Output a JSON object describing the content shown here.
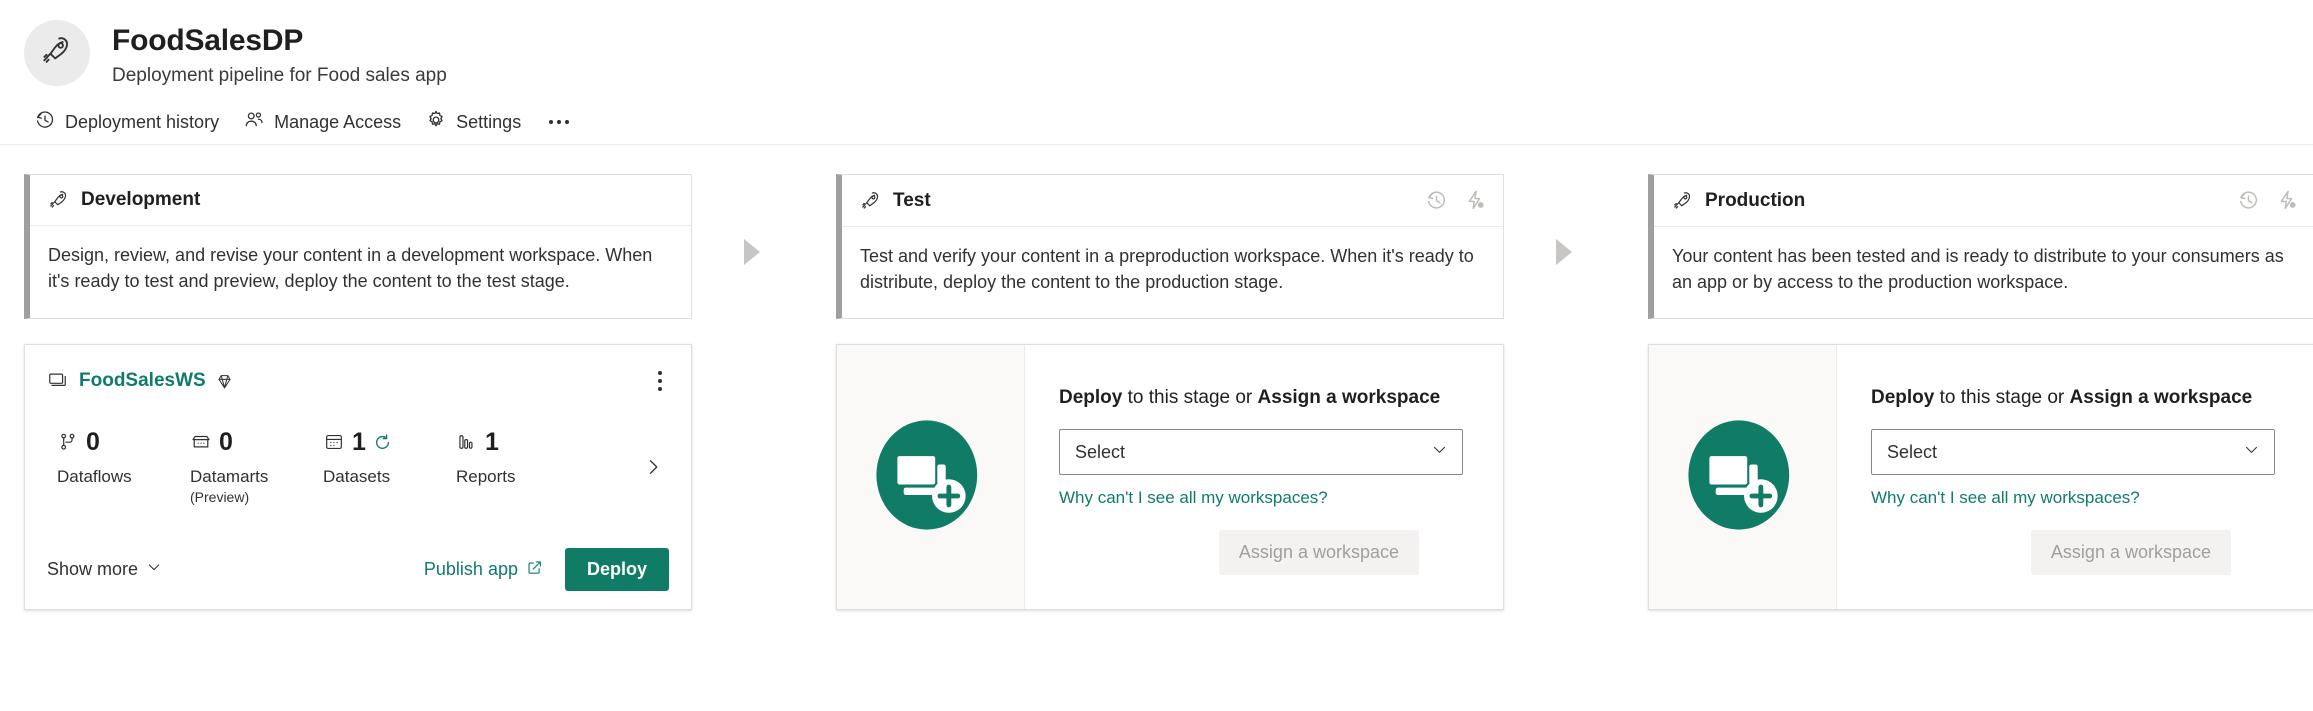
{
  "header": {
    "avatar_icon": "rocket-icon",
    "title": "FoodSalesDP",
    "subtitle": "Deployment pipeline for Food sales app"
  },
  "toolbar": {
    "items": [
      {
        "label": "Deployment history",
        "icon": "history-icon"
      },
      {
        "label": "Manage Access",
        "icon": "people-icon"
      },
      {
        "label": "Settings",
        "icon": "gear-icon"
      }
    ],
    "overflow_label": "More options"
  },
  "colors": {
    "accent_teal": "#107c66",
    "link_teal": "#0f7b6c",
    "stage_accent_bar": "#a19f9d",
    "connector": "#c8c6c4"
  },
  "stages": [
    {
      "name": "Development",
      "icon": "rocket-icon",
      "description": "Design, review, and revise your content in a development workspace. When it's ready to test and preview, deploy the content to the test stage.",
      "head_icons": []
    },
    {
      "name": "Test",
      "icon": "rocket-icon",
      "description": "Test and verify your content in a preproduction workspace. When it's ready to distribute, deploy the content to the production stage.",
      "head_icons": [
        "history-icon",
        "deployment-rules-icon"
      ]
    },
    {
      "name": "Production",
      "icon": "rocket-icon",
      "description": "Your content has been tested and is ready to distribute to your consumers as an app or by access to the production workspace.",
      "head_icons": [
        "history-icon",
        "deployment-rules-icon"
      ]
    }
  ],
  "workspace_card": {
    "name": "FoodSalesWS",
    "workspace_icon": "workspace-icon",
    "premium_icon": "diamond-icon",
    "more_menu_label": "More options",
    "metrics": [
      {
        "count": "0",
        "label": "Dataflows",
        "sublabel": "",
        "icon": "dataflow-icon",
        "has_refresh": false
      },
      {
        "count": "0",
        "label": "Datamarts",
        "sublabel": "(Preview)",
        "icon": "datamart-icon",
        "has_refresh": false
      },
      {
        "count": "1",
        "label": "Datasets",
        "sublabel": "",
        "icon": "dataset-icon",
        "has_refresh": true
      },
      {
        "count": "1",
        "label": "Reports",
        "sublabel": "",
        "icon": "report-icon",
        "has_refresh": false
      }
    ],
    "next_icon": "chevron-right-icon",
    "show_more_label": "Show more",
    "publish_app_label": "Publish app",
    "deploy_label": "Deploy"
  },
  "empty_stage": {
    "illustration_icon": "add-workspace-illustration",
    "title_part1": "Deploy",
    "title_part2": " to this stage or ",
    "title_part3": "Assign a workspace",
    "select_value": "Select",
    "select_placeholder": "Select",
    "why_link_label": "Why can't I see all my workspaces?",
    "assign_label": "Assign a workspace"
  }
}
